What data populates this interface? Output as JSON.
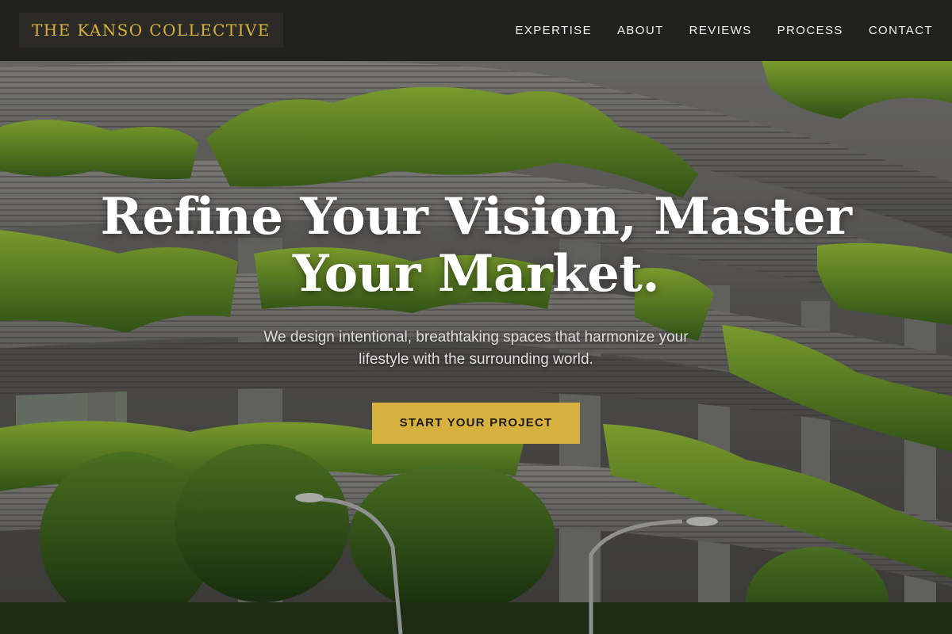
{
  "brand": {
    "name": "THE KANSO COLLECTIVE"
  },
  "nav": {
    "items": [
      {
        "label": "EXPERTISE"
      },
      {
        "label": "ABOUT"
      },
      {
        "label": "REVIEWS"
      },
      {
        "label": "PROCESS"
      },
      {
        "label": "CONTACT"
      }
    ]
  },
  "hero": {
    "heading_line1": "Refine Your Vision, Master",
    "heading_line2": "Your Market.",
    "subtitle_line1": "We design intentional, breathtaking spaces that harmonize your",
    "subtitle_line2": "lifestyle with the surrounding world.",
    "cta_label": "START YOUR PROJECT",
    "background_image": "green-terraced-building-photo"
  },
  "colors": {
    "accent": "#d7b13e",
    "header_bg": "#1c1c1a",
    "text_light": "#ffffff",
    "foliage": "#6f9a2a",
    "concrete": "#6e6e6c"
  }
}
